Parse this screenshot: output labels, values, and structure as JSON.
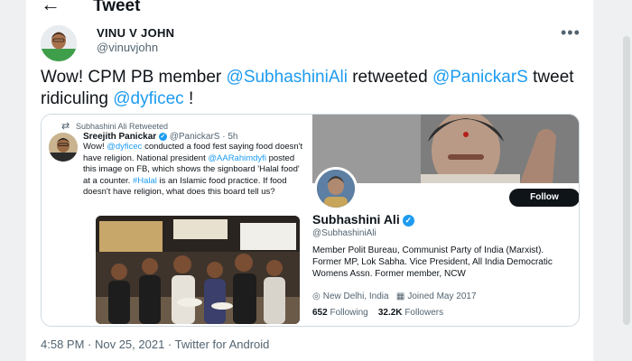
{
  "header": {
    "back_icon": "←",
    "title": "Tweet"
  },
  "author": {
    "name": "VINU V JOHN",
    "handle": "@vinuvjohn",
    "more_icon": "•••"
  },
  "tweet": {
    "text_1": "Wow! CPM PB member ",
    "mention_1": "@SubhashiniAli",
    "text_2": " retweeted ",
    "mention_2": "@PanickarS",
    "text_3": " tweet ridiculing ",
    "mention_3": "@dyficec",
    "text_4": " !"
  },
  "media": {
    "retweet": {
      "rt_icon": "⇄",
      "retweeted_by": "Subhashini Ali Retweeted",
      "name": "Sreejith Panickar",
      "verified_icon": "✓",
      "handle": "@PanickarS · 5h",
      "t1": "Wow! ",
      "m1": "@dyficec",
      "t2": " conducted a food fest saying food doesn't have religion. National president ",
      "m2": "@AARahimdyfi",
      "t3": " posted this image on FB, which shows the signboard 'Halal food' at a counter. ",
      "m3": "#Halal",
      "t4": " is an Islamic food practice. If food doesn't have religion, what does this board tell us?"
    },
    "profile": {
      "follow_label": "Follow",
      "name": "Subhashini Ali",
      "verified_icon": "✓",
      "handle": "@SubhashiniAli",
      "bio": "Member Polit Bureau, Communist Party of India (Marxist). Former MP, Lok Sabha. Vice President, All India Democratic Womens Assn. Former member, NCW",
      "location_icon": "◎",
      "location": "New Delhi, India",
      "calendar_icon": "▦",
      "joined": "Joined May 2017",
      "following_count": "652",
      "following_label": "Following",
      "followers_count": "32.2K",
      "followers_label": "Followers"
    }
  },
  "timestamp": "4:58 PM · Nov 25, 2021 · Twitter for Android",
  "colors": {
    "link": "#1d9bf0",
    "text": "#0f1419",
    "muted": "#536471"
  }
}
